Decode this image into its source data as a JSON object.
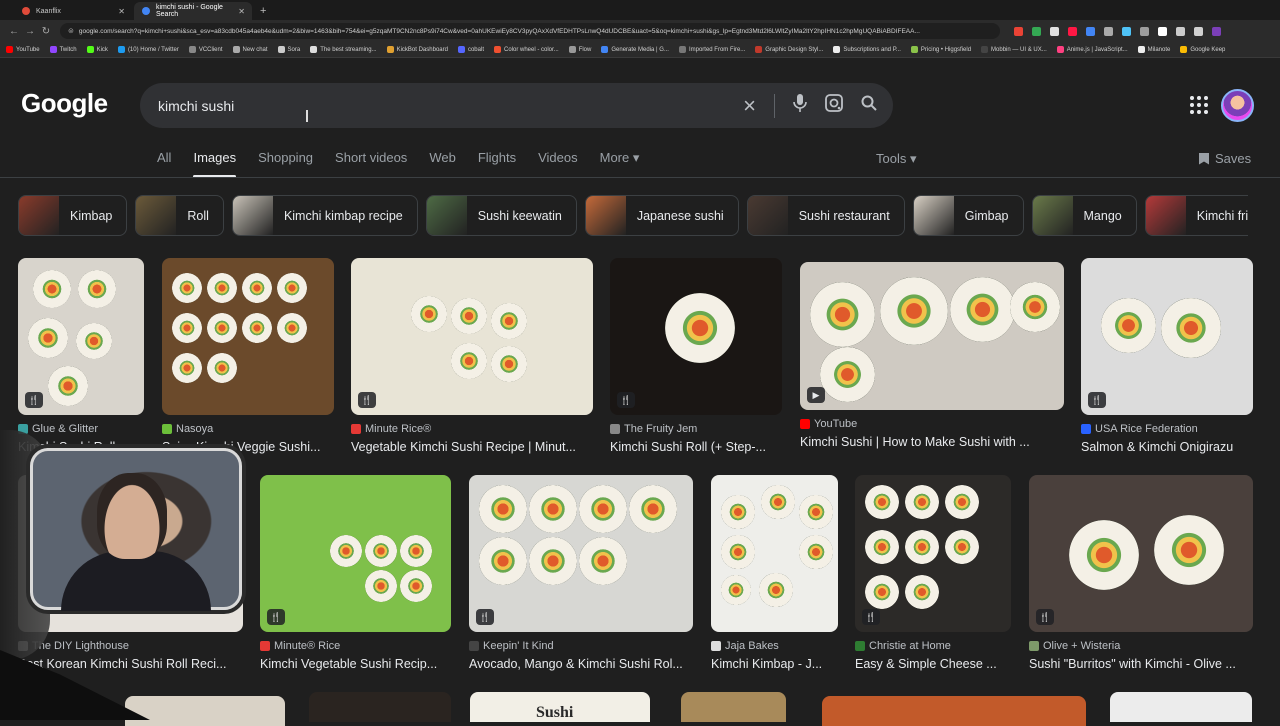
{
  "browser": {
    "tabs": [
      {
        "title": "Kaanflix",
        "active": false,
        "color": "#e04b3a"
      },
      {
        "title": "kimchi sushi - Google Search",
        "active": true,
        "color": "#4285f4"
      }
    ],
    "url": "google.com/search?q=kimchi+sushi&sca_esv=a83cdb045a4aeb4e&udm=2&biw=1463&bih=754&ei=g5zqaMT9CN2nc8Ps9i74Cw&ved=0ahUKEwiEy8CV3pyQAxXdVfEDHTPsLnwQ4dUDCBE&uact=5&oq=kimchi+sushi&gs_lp=Egtnd3Mtd2l6LWltZyIMa2ltY2hpIHN1c2hpMgUQABiABDIFEAA...",
    "bookmarks": [
      "YouTube",
      "Twitch",
      "Kick",
      "(10) Home / Twitter",
      "VCClient",
      "New chat",
      "Sora",
      "The best streaming...",
      "KickBot Dashboard",
      "cobalt",
      "Color wheel - color...",
      "Flow",
      "Generate Media | G...",
      "Imported From Fire...",
      "Graphic Design Styl...",
      "Subscriptions and P...",
      "Pricing • Higgsfield",
      "Mobbin — UI & UX...",
      "Anime.js | JavaScript...",
      "Milanote",
      "Google Keep"
    ],
    "bookmark_colors": [
      "#ff0000",
      "#9146ff",
      "#53fc18",
      "#1d9bf0",
      "#888888",
      "#aaaaaa",
      "#cccccc",
      "#dddddd",
      "#e0a030",
      "#5566ff",
      "#f05030",
      "#999999",
      "#4285f4",
      "#777777",
      "#c0392b",
      "#eeeeee",
      "#8bc34a",
      "#444444",
      "#ff4081",
      "#eeeeee",
      "#fbbc04"
    ],
    "ext_colors": [
      "#ea4335",
      "#34a853",
      "#e0e0e0",
      "#ff1744",
      "#4285f4",
      "#aaaaaa",
      "#4fc3f7",
      "#9e9e9e",
      "#ffffff",
      "#cccccc",
      "#d0d0d0",
      "#7b3fb8"
    ]
  },
  "google": {
    "logo": "Google",
    "query": "kimchi sushi",
    "tabs": [
      "All",
      "Images",
      "Shopping",
      "Short videos",
      "Web",
      "Flights",
      "Videos",
      "More ▾"
    ],
    "active_tab": "Images",
    "tools": "Tools ▾",
    "saves": "Saves",
    "icons": {
      "clear": "×",
      "mic": "🎙",
      "lens": "⌾",
      "search": "⚲"
    }
  },
  "chips": [
    {
      "label": "Kimbap",
      "color": "#8a3b2b"
    },
    {
      "label": "Roll",
      "color": "#6b5a3a"
    },
    {
      "label": "Kimchi kimbap recipe",
      "color": "#c9c3b8"
    },
    {
      "label": "Sushi keewatin",
      "color": "#4e6b45"
    },
    {
      "label": "Japanese sushi",
      "color": "#c56a3a"
    },
    {
      "label": "Sushi restaurant",
      "color": "#4a3a32"
    },
    {
      "label": "Gimbap",
      "color": "#d8d0c4"
    },
    {
      "label": "Mango",
      "color": "#6a7a4a"
    },
    {
      "label": "Kimchi fri",
      "color": "#b53a3a"
    }
  ],
  "results": [
    {
      "source": "Glue & Glitter",
      "title": "Kimchi Sushi Rolls...",
      "badge": "🍴",
      "bg": "#d8d4cc",
      "sfav": "#3aa0a0"
    },
    {
      "source": "Nasoya",
      "title": "Spicy Kimchi Veggie Sushi...",
      "badge": "",
      "bg": "#6b4a2b",
      "sfav": "#6cbf3a"
    },
    {
      "source": "Minute Rice®",
      "title": "Vegetable Kimchi Sushi Recipe | Minut...",
      "badge": "🍴",
      "bg": "#e8e4d6",
      "sfav": "#e53935"
    },
    {
      "source": "The Fruity Jem",
      "title": "Kimchi Sushi Roll (+ Step-...",
      "badge": "🍴",
      "bg": "#1a1614",
      "sfav": "#888888"
    },
    {
      "source": "YouTube",
      "title": "Kimchi Sushi | How to Make Sushi with ...",
      "badge": "▶",
      "bg": "#cfcac2",
      "sfav": "#ff0000"
    },
    {
      "source": "USA Rice Federation",
      "title": "Salmon & Kimchi Onigirazu",
      "badge": "🍴",
      "bg": "#dcdcdc",
      "sfav": "#2962ff"
    },
    {
      "source": "The DIY Lighthouse",
      "title": "Best Korean Kimchi Sushi Roll Reci...",
      "badge": "",
      "bg": "#e6e2dc",
      "sfav": "#ffffff"
    },
    {
      "source": "Minute® Rice",
      "title": "Kimchi Vegetable Sushi Recip...",
      "badge": "🍴",
      "bg": "#7fc04a",
      "sfav": "#e53935"
    },
    {
      "source": "Keepin' It Kind",
      "title": "Avocado, Mango & Kimchi Sushi Rol...",
      "badge": "🍴",
      "bg": "#d7d7d3",
      "sfav": "#444444"
    },
    {
      "source": "Jaja Bakes",
      "title": "Kimchi Kimbap - J...",
      "badge": "",
      "bg": "#eeeeea",
      "sfav": "#dddddd"
    },
    {
      "source": "Christie at Home",
      "title": "Easy & Simple Cheese ...",
      "badge": "🍴",
      "bg": "#2c2a28",
      "sfav": "#2e7d32"
    },
    {
      "source": "Olive + Wisteria",
      "title": "Sushi \"Burritos\" with Kimchi - Olive ...",
      "badge": "🍴",
      "bg": "#4a403c",
      "sfav": "#7e9a6a"
    }
  ],
  "bottom_row_text": "Sushi"
}
